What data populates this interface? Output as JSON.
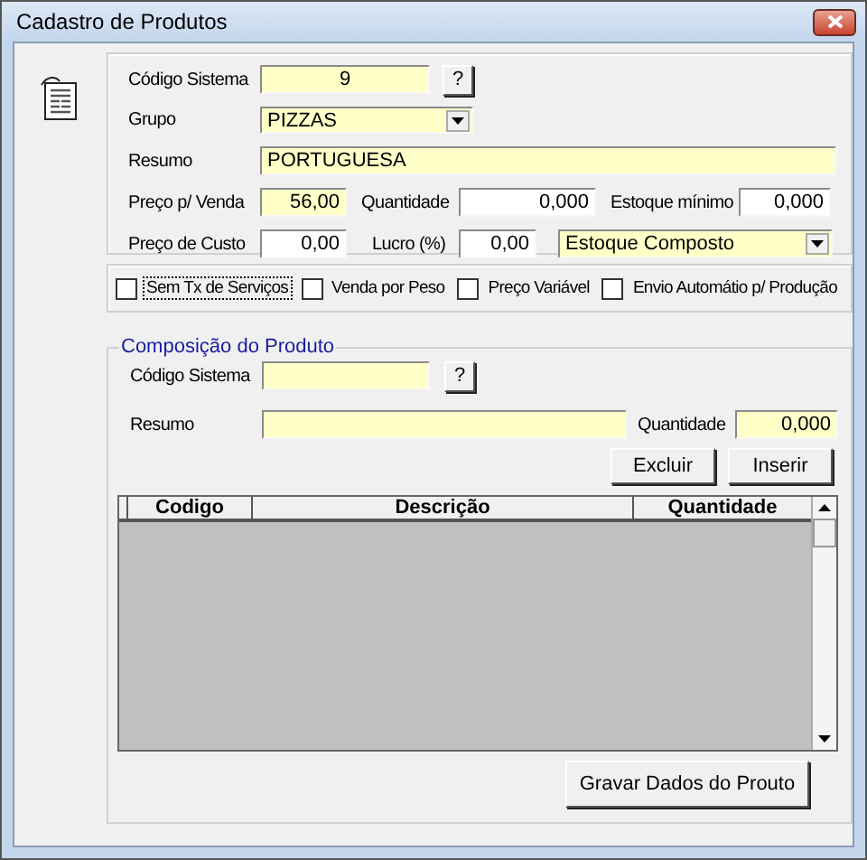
{
  "window": {
    "title": "Cadastro de Produtos"
  },
  "main_form": {
    "rows": [
      [
        {
          "kind": "label",
          "text": "Código Sistema"
        },
        {
          "kind": "code_field",
          "value": "9",
          "highlighted": true
        },
        {
          "kind": "button",
          "text": "?"
        }
      ],
      [
        {
          "kind": "label",
          "text": "Grupo"
        },
        {
          "kind": "combo",
          "value": "PIZZAS",
          "highlighted": true
        }
      ],
      [
        {
          "kind": "label",
          "text": "Resumo"
        },
        {
          "kind": "text_field",
          "value": "PORTUGUESA",
          "highlighted": true
        }
      ],
      [
        {
          "kind": "label",
          "text": "Preço p/ Venda"
        },
        {
          "kind": "number_field",
          "value": "56,00",
          "highlighted": true
        },
        {
          "kind": "label",
          "text": "Quantidade"
        },
        {
          "kind": "number_field",
          "value": "0,000",
          "highlighted": false
        },
        {
          "kind": "label",
          "text": "Estoque mínimo"
        },
        {
          "kind": "number_field",
          "value": "0,000",
          "highlighted": false
        }
      ],
      [
        {
          "kind": "label",
          "text": "Preço de Custo"
        },
        {
          "kind": "number_field",
          "value": "0,00",
          "highlighted": false
        },
        {
          "kind": "label",
          "text": "Lucro (%)"
        },
        {
          "kind": "number_field",
          "value": "0,00",
          "highlighted": false
        },
        {
          "kind": "combo",
          "value": "Estoque Composto",
          "highlighted": true
        }
      ]
    ]
  },
  "options": [
    {
      "label": "Sem Tx de Serviços",
      "checked": false,
      "focused": true
    },
    {
      "label": "Venda por Peso",
      "checked": false,
      "focused": false
    },
    {
      "label": "Preço Variável",
      "checked": false,
      "focused": false
    },
    {
      "label": "Envio Automátio p/ Produção",
      "checked": false,
      "focused": false
    }
  ],
  "composition": {
    "title": "Composição do Produto",
    "rows": [
      [
        {
          "kind": "label",
          "text": "Código Sistema"
        },
        {
          "kind": "code_field",
          "highlighted": true
        },
        {
          "kind": "button",
          "text": "?"
        }
      ],
      [
        {
          "kind": "label",
          "text": "Resumo"
        },
        {
          "kind": "text_field",
          "highlighted": true
        },
        {
          "kind": "label",
          "text": "Quantidade"
        },
        {
          "kind": "number_field",
          "value": "0,000",
          "highlighted": true
        }
      ]
    ],
    "buttons": [
      "Excluir",
      "Inserir"
    ],
    "table": {
      "columns": [
        "Codigo",
        "Descrição",
        "Quantidade"
      ]
    }
  },
  "save_button": "Gravar Dados do Prouto"
}
